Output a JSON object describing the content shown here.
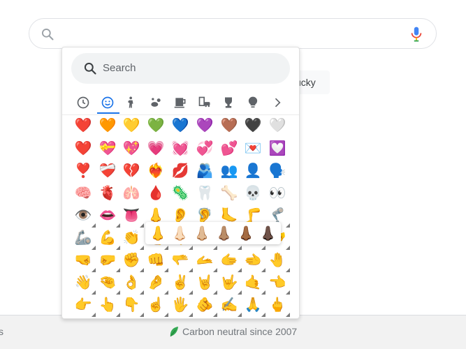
{
  "search": {
    "placeholder": ""
  },
  "lucky_button": {
    "label": "ucky"
  },
  "footer": {
    "left_text": "s",
    "carbon_text": "Carbon neutral since 2007"
  },
  "emoji_picker": {
    "search_placeholder": "Search",
    "categories": [
      {
        "icon": "clock-icon"
      },
      {
        "icon": "smiley-icon",
        "active": true
      },
      {
        "icon": "person-icon"
      },
      {
        "icon": "animal-icon"
      },
      {
        "icon": "food-icon"
      },
      {
        "icon": "travel-icon"
      },
      {
        "icon": "trophy-icon"
      },
      {
        "icon": "lightbulb-icon"
      },
      {
        "icon": "chevron-right-icon"
      }
    ],
    "rows": [
      [
        "❤️",
        "🧡",
        "💛",
        "💚",
        "💙",
        "💜",
        "🤎",
        "🖤",
        "🤍"
      ],
      [
        "❤️",
        "💝",
        "💖",
        "💗",
        "💓",
        "💞",
        "💕",
        "💌",
        "💟"
      ],
      [
        "❣️",
        "❤️‍🩹",
        "💔",
        "❤️‍🔥",
        "💋",
        "🫂",
        "👥",
        "👤",
        "🗣️"
      ],
      [
        "🧠",
        "🫀",
        "🫁",
        "🩸",
        "🦠",
        "🦷",
        "🦴",
        "💀",
        "👀"
      ],
      [
        "👁️",
        "👄",
        "👅",
        "👃",
        "👂",
        "🦻",
        "🦶",
        "🦵",
        "🦿"
      ],
      [
        "🦾",
        "💪",
        "👏",
        "👍",
        "👎",
        "🙌",
        "👐",
        "🤲",
        "🤝"
      ],
      [
        "🤜",
        "🤛",
        "✊",
        "👊",
        "🫳",
        "🫴",
        "🫱",
        "🫲",
        "🤚"
      ],
      [
        "👋",
        "🤏",
        "👌",
        "🤌",
        "✌️",
        "🤘",
        "🤟",
        "🤙",
        "👈"
      ],
      [
        "👉",
        "👆",
        "👇",
        "☝️",
        "🖐️",
        "🫵",
        "✍️",
        "🙏",
        "🖕"
      ]
    ],
    "skin_tones": [
      "👃",
      "👃🏻",
      "👃🏼",
      "👃🏽",
      "👃🏾",
      "👃🏿"
    ]
  }
}
